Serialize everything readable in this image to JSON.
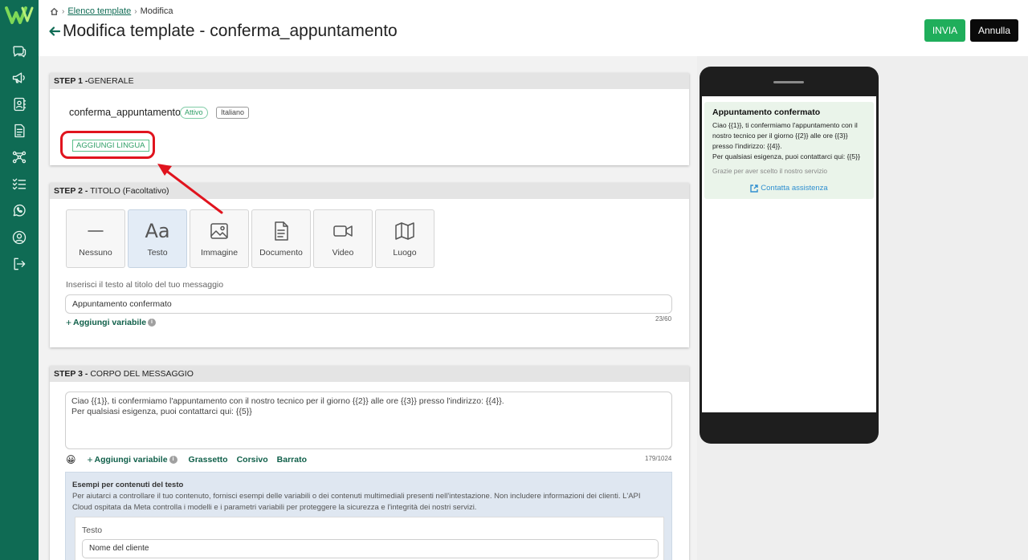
{
  "sidebar": {
    "logo": "W",
    "items": [
      "chat-icon",
      "megaphone-icon",
      "contacts-icon",
      "document-icon",
      "flow-icon",
      "checklist-icon",
      "whatsapp-icon",
      "user-icon",
      "logout-icon"
    ]
  },
  "breadcrumb": {
    "home_icon": "home-icon",
    "link": "Elenco template",
    "current": "Modifica"
  },
  "header": {
    "title": "Modifica template - conferma_appuntamento",
    "send_label": "INVIA",
    "cancel_label": "Annulla",
    "send_color": "#1fae5b"
  },
  "step1": {
    "heading_bold": "STEP 1 -",
    "heading_rest": "GENERALE",
    "template_name": "conferma_appuntamento",
    "status_badge": "Attivo",
    "language_badge": "Italiano",
    "add_language_label": "AGGIUNGI LINGUA"
  },
  "step2": {
    "heading_bold": "STEP 2 -",
    "heading_rest": " TITOLO (Facoltativo)",
    "types": [
      {
        "label": "Nessuno",
        "icon": "dash-icon"
      },
      {
        "label": "Testo",
        "icon": "text-aa-icon",
        "glyph": "Aa",
        "selected": true
      },
      {
        "label": "Immagine",
        "icon": "image-icon"
      },
      {
        "label": "Documento",
        "icon": "document-icon"
      },
      {
        "label": "Video",
        "icon": "video-icon"
      },
      {
        "label": "Luogo",
        "icon": "map-icon"
      }
    ],
    "title_field_label": "Inserisci il testo al titolo del tuo messaggio",
    "title_value": "Appuntamento confermato",
    "add_variable_label": "Aggiungi variabile",
    "counter": "23/60"
  },
  "step3": {
    "heading_bold": "STEP 3 -",
    "heading_rest": " CORPO DEL MESSAGGIO",
    "body_line1": "Ciao {{1}}, ti confermiamo l'appuntamento con il nostro tecnico per il giorno {{2}} alle ore {{3}} presso l'indirizzo: {{4}}.",
    "body_line2": "Per qualsiasi esigenza, puoi contattarci qui: {{5}}",
    "emoji": "😀",
    "add_variable_label": "Aggiungi variabile",
    "bold_label": "Grassetto",
    "italic_label": "Corsivo",
    "strike_label": "Barrato",
    "counter": "179/1024",
    "examples_title": "Esempi per contenuti del testo",
    "examples_text": "Per aiutarci a controllare il tuo contenuto, fornisci esempi delle variabili o dei contenuti multimediali presenti nell'intestazione. Non includere informazioni dei clienti. L'API Cloud ospitata da Meta controlla i modelli e i parametri variabili per proteggere la sicurezza e l'integrità dei nostri servizi.",
    "example_label": "Testo",
    "example_value": "Nome del cliente"
  },
  "preview": {
    "title": "Appuntamento confermato",
    "body_lines": [
      "Ciao {{1}}, ti confermiamo l'appuntamento con il",
      "nostro tecnico per il giorno {{2}} alle ore {{3}}",
      "presso l'indirizzo: {{4}}.",
      "Per qualsiasi esigenza, puoi contattarci qui: {{5}}"
    ],
    "footer": "Grazie per aver scelto il nostro servizio",
    "cta_label": "Contatta assistenza"
  },
  "annotation": {
    "highlight_color": "#e0141e"
  }
}
